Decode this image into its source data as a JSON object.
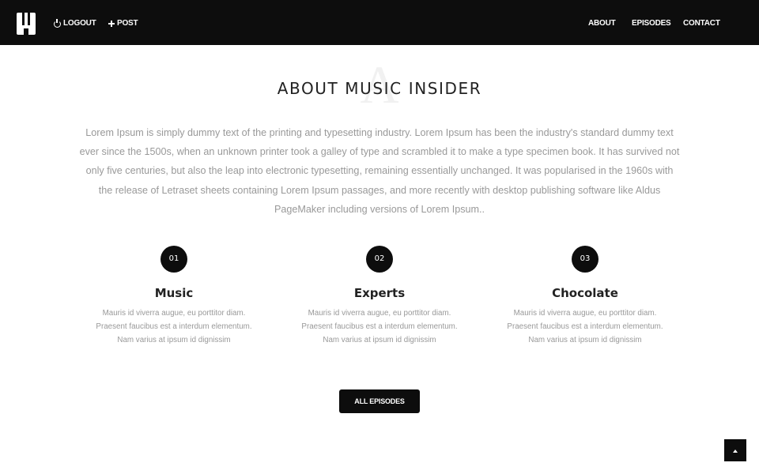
{
  "nav": {
    "logout_label": "LOGOUT",
    "post_label": "POST",
    "about_label": "ABOUT",
    "episodes_label": "EPISODES",
    "contact_label": "CONTACT"
  },
  "about": {
    "watermark_letter": "A",
    "title": "ABOUT MUSIC INSIDER",
    "intro": "Lorem Ipsum is simply dummy text of the printing and typesetting industry. Lorem Ipsum has been the industry's standard dummy text ever since the 1500s, when an unknown printer took a galley of type and scrambled it to make a type specimen book. It has survived not only five centuries, but also the leap into electronic typesetting, remaining essentially unchanged. It was popularised in the 1960s with the release of Letraset sheets containing Lorem Ipsum passages, and more recently with desktop publishing software like Aldus PageMaker including versions of Lorem Ipsum.."
  },
  "features": [
    {
      "number": "01",
      "title": "Music",
      "text": "Mauris id viverra augue, eu porttitor diam. Praesent faucibus est a interdum elementum. Nam varius at ipsum id dignissim"
    },
    {
      "number": "02",
      "title": "Experts",
      "text": "Mauris id viverra augue, eu porttitor diam. Praesent faucibus est a interdum elementum. Nam varius at ipsum id dignissim"
    },
    {
      "number": "03",
      "title": "Chocolate",
      "text": "Mauris id viverra augue, eu porttitor diam. Praesent faucibus est a interdum elementum. Nam varius at ipsum id dignissim"
    }
  ],
  "cta": {
    "all_episodes_label": "ALL EPISODES"
  },
  "icons": {
    "logout": "power-icon",
    "post": "plus-icon",
    "scroll_top": "chevron-up-icon",
    "logo": "logo-m"
  },
  "colors": {
    "navbar_bg": "#0d0d0d",
    "accent_dark": "#0d0d0d",
    "body_text": "#999999",
    "heading_text": "#222222"
  }
}
